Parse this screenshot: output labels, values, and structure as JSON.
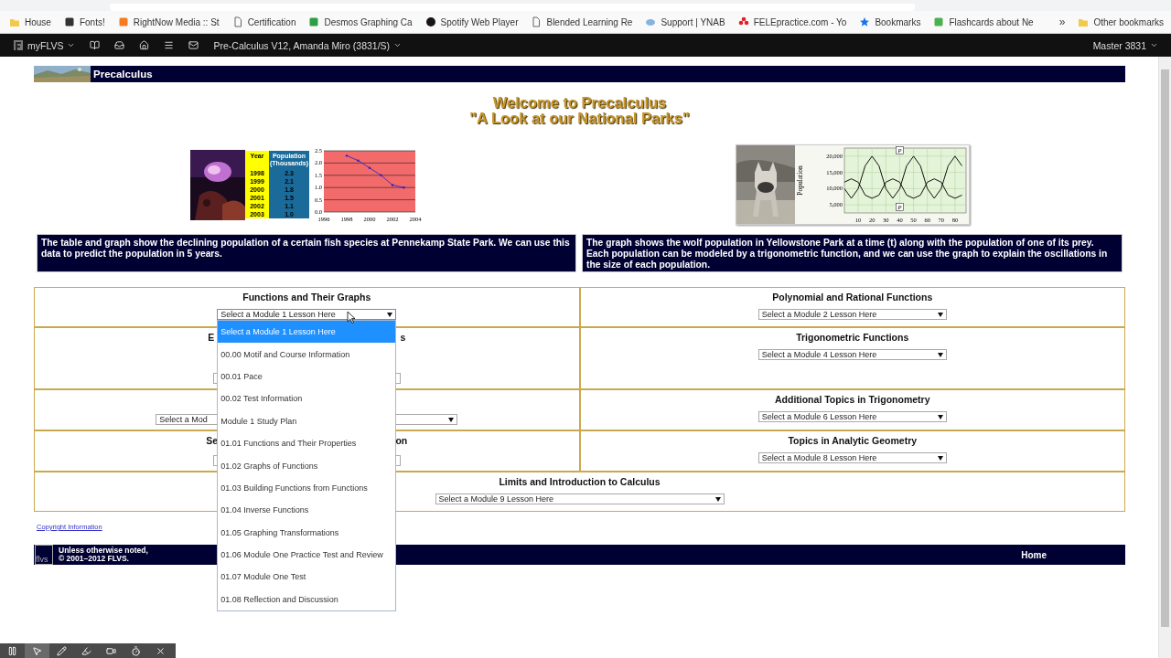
{
  "browser": {
    "bookmarks": [
      "House",
      "Fonts!",
      "RightNow Media :: St",
      "Certification",
      "Desmos Graphing Ca",
      "Spotify Web Player",
      "Blended Learning Re",
      "Support | YNAB",
      "FELEpractice.com - Yo",
      "Bookmarks",
      "Flashcards about Ne"
    ],
    "overflow": "»",
    "other": "Other bookmarks"
  },
  "nav": {
    "brand": "myFLVS",
    "course": "Pre-Calculus V12, Amanda Miro (3831/S)",
    "user": "Master 3831"
  },
  "banner": {
    "title": "Precalculus"
  },
  "welcome": [
    "Welcome to Precalculus",
    "\"A Look at our National Parks\""
  ],
  "features": [
    {
      "kind": "fish",
      "table": {
        "columns": [
          "Year",
          "Population (Thousands)"
        ],
        "rows": [
          [
            "1998",
            "2.3"
          ],
          [
            "1999",
            "2.1"
          ],
          [
            "2000",
            "1.8"
          ],
          [
            "2001",
            "1.5"
          ],
          [
            "2002",
            "1.1"
          ],
          [
            "2003",
            "1.0"
          ]
        ]
      },
      "chart_data": {
        "type": "line",
        "x": [
          1998,
          1999,
          2000,
          2001,
          2002,
          2003
        ],
        "series": [
          {
            "color": "#2222cc",
            "values": [
              2.3,
              2.1,
              1.8,
              1.5,
              1.1,
              1.0
            ]
          }
        ],
        "xlim": [
          1996,
          2004
        ],
        "ylim": [
          0,
          2.5
        ],
        "xticks": [
          1996,
          1998,
          2000,
          2002,
          2004
        ],
        "yticks": [
          {
            "value": 0,
            "label": "0.0"
          },
          {
            "value": 0.5,
            "label": "0.5"
          },
          {
            "value": 1,
            "label": "1.0"
          },
          {
            "value": 1.5,
            "label": "1.5"
          },
          {
            "value": 2,
            "label": "2.0"
          },
          {
            "value": 2.5,
            "label": "2.5"
          }
        ],
        "grid": true
      },
      "caption": "The table and graph show the declining population of a certain fish species at Pennekamp State Park. We can use this data to predict the population in 5 years."
    },
    {
      "kind": "wolf",
      "chart_data": {
        "type": "line",
        "ylabel": "Population",
        "x": [
          0,
          5,
          10,
          15,
          20,
          25,
          30,
          35,
          40,
          45,
          50,
          55,
          60,
          65,
          70,
          75,
          80,
          85
        ],
        "series": [
          {
            "color": "#111111",
            "values": [
              10000,
              7000,
              10000,
              17000,
              20000,
              17000,
              10000,
              7000,
              10000,
              17000,
              20000,
              17000,
              10000,
              7000,
              10000,
              17000,
              20000,
              17000
            ]
          },
          {
            "color": "#111111",
            "values": [
              12000,
              13000,
              12000,
              8000,
              7000,
              8000,
              12000,
              13000,
              12000,
              8000,
              7000,
              8000,
              12000,
              13000,
              12000,
              8000,
              7000,
              8000
            ]
          }
        ],
        "xlim": [
          0,
          88
        ],
        "ylim": [
          2500,
          22500
        ],
        "xticks": [
          10,
          20,
          30,
          40,
          50,
          60,
          70,
          80
        ],
        "yticks": [
          {
            "value": 5000,
            "label": "5,000"
          },
          {
            "value": 10000,
            "label": "10,000"
          },
          {
            "value": 15000,
            "label": "15,000"
          },
          {
            "value": 20000,
            "label": "20,000"
          }
        ],
        "grid": true,
        "annotations": [
          {
            "x": 40,
            "y": 21500,
            "text": "P"
          },
          {
            "x": 40,
            "y": 4000,
            "text": "P"
          }
        ]
      },
      "caption": "The graph shows the wolf population in Yellowstone Park at a time (t) along with the population of one of its prey. Each population can be modeled by a trigonometric function, and we can use the graph to explain the oscillations in the size of each population."
    }
  ],
  "modules": [
    {
      "cells": [
        {
          "kind": "open",
          "heading": "Functions and Their Graphs",
          "select": "Select a Module 1 Lesson Here",
          "options": [
            {
              "label": "Select a Module 1 Lesson Here",
              "selected": true
            },
            {
              "label": "00.00 Motif and Course Information",
              "selected": false
            },
            {
              "label": "00.01 Pace",
              "selected": false
            },
            {
              "label": "00.02 Test Information",
              "selected": false
            },
            {
              "label": "Module 1 Study Plan",
              "selected": false
            },
            {
              "label": "01.01 Functions and Their Properties",
              "selected": false
            },
            {
              "label": "01.02 Graphs of Functions",
              "selected": false
            },
            {
              "label": "01.03 Building Functions from Functions",
              "selected": false
            },
            {
              "label": "01.04 Inverse Functions",
              "selected": false
            },
            {
              "label": "01.05 Graphing Transformations",
              "selected": false
            },
            {
              "label": "01.06 Module One Practice Test and Review",
              "selected": false
            },
            {
              "label": "01.07 Module One Test",
              "selected": false
            },
            {
              "label": "01.08 Reflection and Discussion",
              "selected": false
            }
          ]
        },
        {
          "kind": "plain",
          "heading": "Polynomial and Rational Functions",
          "select": "Select a Module 2 Lesson Here"
        }
      ]
    },
    {
      "cells": [
        {
          "kind": "covered",
          "heading_fragments": [
            "E",
            "s"
          ]
        },
        {
          "kind": "plain",
          "heading": "Trigonometric Functions",
          "select": "Select a Module 4 Lesson Here"
        }
      ]
    },
    {
      "cells": [
        {
          "kind": "covered",
          "select_fragment": "Select a Mod"
        },
        {
          "kind": "plain",
          "heading": "Additional Topics in Trigonometry",
          "select": "Select a Module 6 Lesson Here"
        }
      ]
    },
    {
      "cells": [
        {
          "kind": "covered",
          "heading_fragments": [
            "Se",
            "on"
          ]
        },
        {
          "kind": "plain",
          "heading": "Topics in Analytic Geometry",
          "select": "Select a Module 8 Lesson Here"
        }
      ]
    },
    {
      "cells": [
        {
          "kind": "plain",
          "heading": "Limits and Introduction to Calculus",
          "select": "Select a Module 9 Lesson Here"
        }
      ]
    }
  ],
  "copyright": "Copyright Information",
  "footer": {
    "logo": "flvs",
    "notice": [
      "Unless otherwise noted,",
      "© 2001–2012 FLVS."
    ],
    "link": "Home"
  },
  "recorder": {
    "tools": [
      {
        "kind": "pause",
        "selected": false
      },
      {
        "kind": "pointer",
        "selected": true
      },
      {
        "kind": "pen",
        "selected": false
      },
      {
        "kind": "marker",
        "selected": false
      },
      {
        "kind": "camera",
        "selected": false
      },
      {
        "kind": "timer",
        "selected": false
      },
      {
        "kind": "close",
        "selected": false
      }
    ]
  }
}
